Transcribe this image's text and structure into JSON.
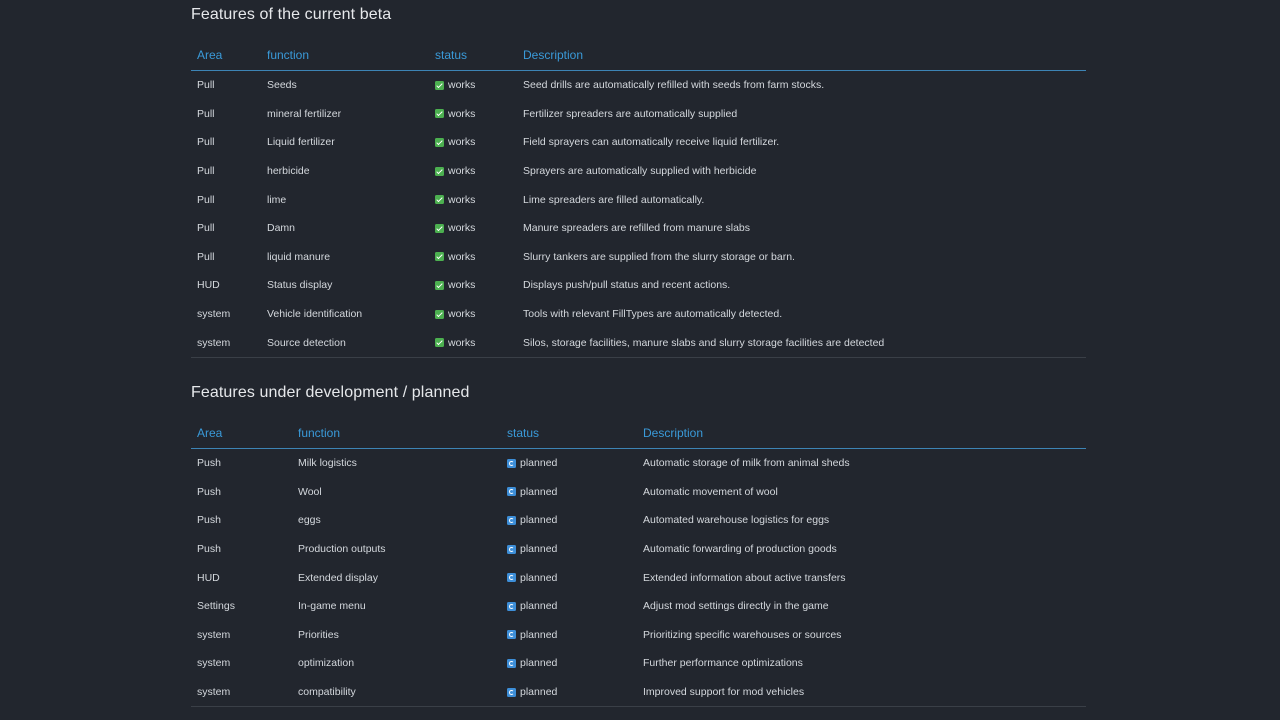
{
  "beta": {
    "title": "Features of the current beta",
    "headers": [
      "Area",
      "function",
      "status",
      "Description"
    ],
    "rows": [
      {
        "area": "Pull",
        "function": "Seeds",
        "status": "works",
        "description": "Seed drills are automatically refilled with seeds from farm stocks."
      },
      {
        "area": "Pull",
        "function": "mineral fertilizer",
        "status": "works",
        "description": "Fertilizer spreaders are automatically supplied"
      },
      {
        "area": "Pull",
        "function": "Liquid fertilizer",
        "status": "works",
        "description": "Field sprayers can automatically receive liquid fertilizer."
      },
      {
        "area": "Pull",
        "function": "herbicide",
        "status": "works",
        "description": "Sprayers are automatically supplied with herbicide"
      },
      {
        "area": "Pull",
        "function": "lime",
        "status": "works",
        "description": "Lime spreaders are filled automatically."
      },
      {
        "area": "Pull",
        "function": "Damn",
        "status": "works",
        "description": "Manure spreaders are refilled from manure slabs"
      },
      {
        "area": "Pull",
        "function": "liquid manure",
        "status": "works",
        "description": "Slurry tankers are supplied from the slurry storage or barn."
      },
      {
        "area": "HUD",
        "function": "Status display",
        "status": "works",
        "description": "Displays push/pull status and recent actions."
      },
      {
        "area": "system",
        "function": "Vehicle identification",
        "status": "works",
        "description": "Tools with relevant FillTypes are automatically detected."
      },
      {
        "area": "system",
        "function": "Source detection",
        "status": "works",
        "description": "Silos, storage facilities, manure slabs and slurry storage facilities are detected"
      }
    ]
  },
  "planned": {
    "title": "Features under development / planned",
    "headers": [
      "Area",
      "function",
      "status",
      "Description"
    ],
    "rows": [
      {
        "area": "Push",
        "function": "Milk logistics",
        "status": "planned",
        "description": "Automatic storage of milk from animal sheds"
      },
      {
        "area": "Push",
        "function": "Wool",
        "status": "planned",
        "description": "Automatic movement of wool"
      },
      {
        "area": "Push",
        "function": "eggs",
        "status": "planned",
        "description": "Automated warehouse logistics for eggs"
      },
      {
        "area": "Push",
        "function": "Production outputs",
        "status": "planned",
        "description": "Automatic forwarding of production goods"
      },
      {
        "area": "HUD",
        "function": "Extended display",
        "status": "planned",
        "description": "Extended information about active transfers"
      },
      {
        "area": "Settings",
        "function": "In-game menu",
        "status": "planned",
        "description": "Adjust mod settings directly in the game"
      },
      {
        "area": "system",
        "function": "Priorities",
        "status": "planned",
        "description": "Prioritizing specific warehouses or sources"
      },
      {
        "area": "system",
        "function": "optimization",
        "status": "planned",
        "description": "Further performance optimizations"
      },
      {
        "area": "system",
        "function": "compatibility",
        "status": "planned",
        "description": "Improved support for mod vehicles"
      }
    ]
  },
  "colors": {
    "background": "#22262e",
    "header_accent": "#3a9ad9",
    "works_icon": "#4cb050",
    "planned_icon": "#3d8ed8"
  },
  "icons": {
    "works": "check-icon",
    "planned": "planned-icon"
  }
}
